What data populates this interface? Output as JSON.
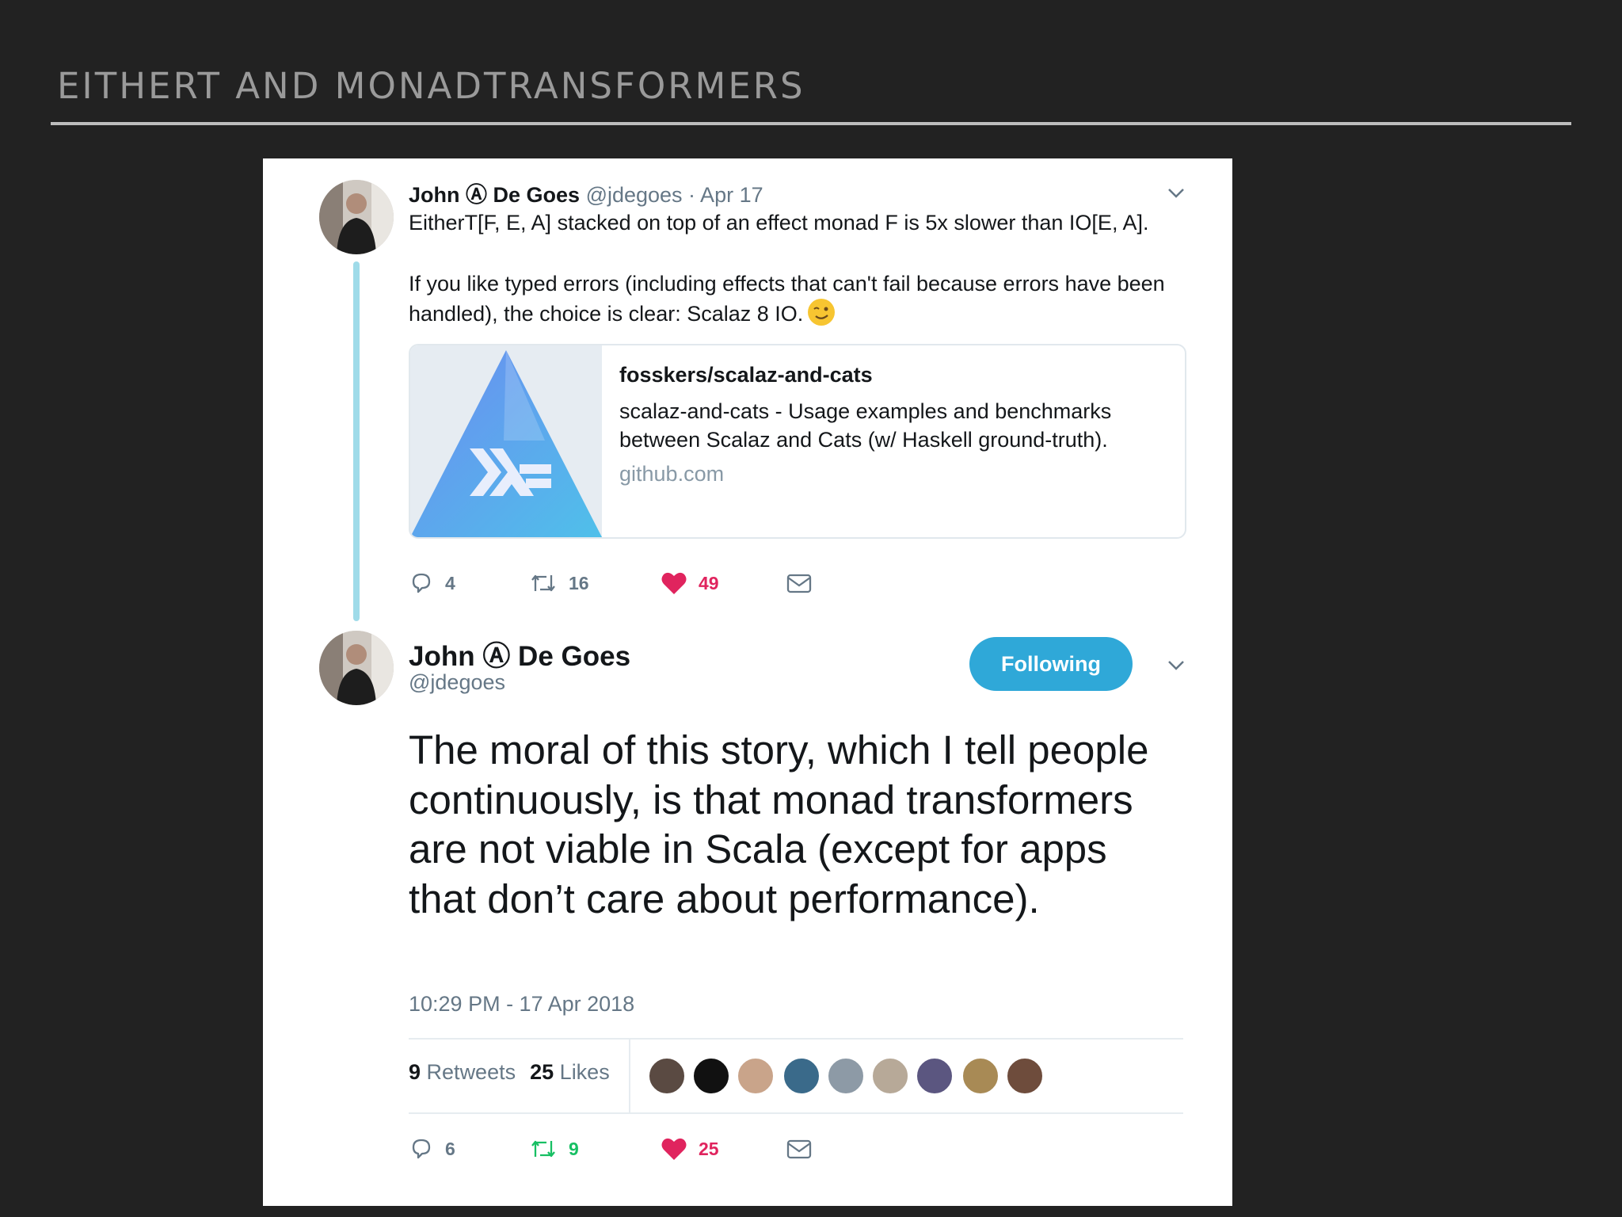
{
  "slide": {
    "title": "EITHERT AND MONADTRANSFORMERS"
  },
  "tweet1": {
    "name": "John Ⓐ De Goes",
    "meta": "@jdegoes · Apr 17",
    "text_p1": "EitherT[F, E, A] stacked on top of an effect monad F is 5x slower than IO[E, A].",
    "text_p2": "If you like typed errors (including effects that can't fail because errors have been handled), the choice is clear: Scalaz 8 IO.",
    "emoji": "winking-face",
    "link_card": {
      "title": "fosskers/scalaz-and-cats",
      "description": "scalaz-and-cats - Usage examples and benchmarks between Scalaz and Cats (w/ Haskell ground-truth).",
      "domain": "github.com"
    },
    "actions": {
      "replies": "4",
      "retweets": "16",
      "likes": "49"
    }
  },
  "tweet2": {
    "name": "John Ⓐ De Goes",
    "handle": "@jdegoes",
    "follow_label": "Following",
    "text": "The moral of this story, which I tell people continuously, is that monad transformers are not viable in Scala (except for apps that don’t care about performance).",
    "timestamp": "10:29 PM - 17 Apr 2018",
    "stats": {
      "retweets_count": "9",
      "retweets_label": "Retweets",
      "likes_count": "25",
      "likes_label": "Likes"
    },
    "actions": {
      "replies": "6",
      "retweets": "9",
      "likes": "25"
    }
  },
  "colors": {
    "like": "#e0245e",
    "retweet_active": "#17bf63",
    "icon_gray": "#657786",
    "follow_button": "#2fa8d8",
    "thread_line": "#9fdbe9"
  }
}
